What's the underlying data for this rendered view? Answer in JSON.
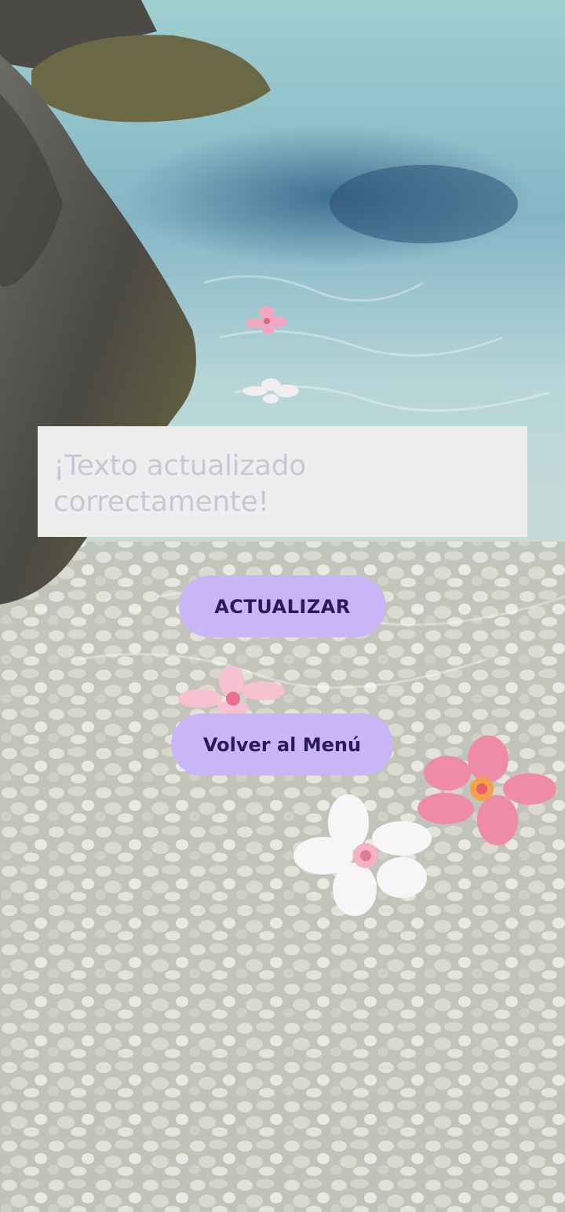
{
  "status_text": "¡Texto actualizado correctamente!",
  "buttons": {
    "update_label": "ACTUALIZAR",
    "menu_label": "Volver al Menú"
  },
  "colors": {
    "textbox_bg": "#eeeeee",
    "textbox_text": "#cdc5d6",
    "button_bg": "#c9b6f7",
    "button_text": "#2b1a5c"
  },
  "icons": [
    "flower-icon"
  ]
}
